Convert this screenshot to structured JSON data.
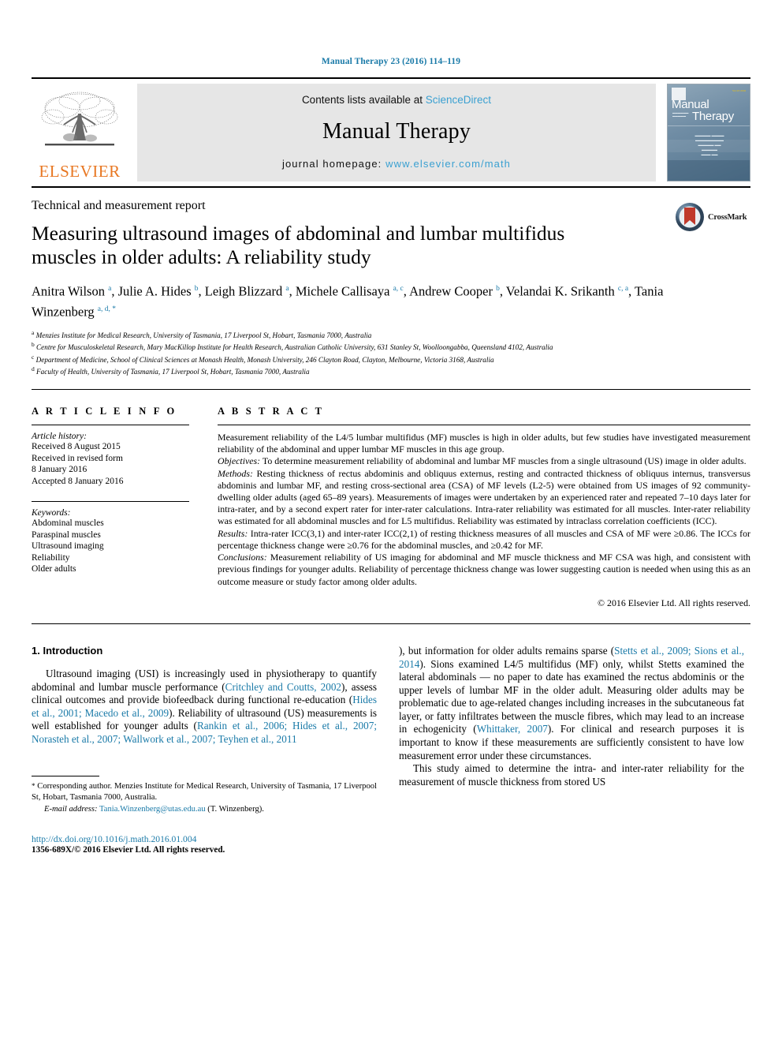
{
  "running_head": "Manual Therapy 23 (2016) 114–119",
  "masthead": {
    "publisher_name": "ELSEVIER",
    "contents_prefix": "Contents lists available at ",
    "contents_link": "ScienceDirect",
    "journal_name": "Manual Therapy",
    "homepage_label": "journal homepage: ",
    "homepage_url": "www.elsevier.com/math",
    "cover": {
      "title_line1": "Manual",
      "title_line2": "Therapy",
      "issue_text": "Vol 23 2016"
    }
  },
  "title_block": {
    "kicker": "Technical and measurement report",
    "title": "Measuring ultrasound images of abdominal and lumbar multifidus muscles in older adults: A reliability study",
    "crossmark_label": "CrossMark",
    "authors": [
      {
        "name": "Anitra Wilson",
        "sup": "a",
        "sep": ", "
      },
      {
        "name": "Julie A. Hides",
        "sup": "b",
        "sep": ", "
      },
      {
        "name": "Leigh Blizzard",
        "sup": "a",
        "sep": ", "
      },
      {
        "name": "Michele Callisaya",
        "sup": "a, c",
        "sep": ", "
      },
      {
        "name": "Andrew Cooper",
        "sup": "b",
        "sep": ", "
      },
      {
        "name": "Velandai K. Srikanth",
        "sup": "c, a",
        "sep": ", "
      },
      {
        "name": "Tania Winzenberg",
        "sup": "a, d, *",
        "sep": ""
      }
    ],
    "affiliations": [
      {
        "marker": "a",
        "text": "Menzies Institute for Medical Research, University of Tasmania, 17 Liverpool St, Hobart, Tasmania 7000, Australia"
      },
      {
        "marker": "b",
        "text": "Centre for Musculoskeletal Research, Mary MacKillop Institute for Health Research, Australian Catholic University, 631 Stanley St, Woolloongabba, Queensland 4102, Australia"
      },
      {
        "marker": "c",
        "text": "Department of Medicine, School of Clinical Sciences at Monash Health, Monash University, 246 Clayton Road, Clayton, Melbourne, Victoria 3168, Australia"
      },
      {
        "marker": "d",
        "text": "Faculty of Health, University of Tasmania, 17 Liverpool St, Hobart, Tasmania 7000, Australia"
      }
    ]
  },
  "article_info": {
    "heading": "A R T I C L E  I N F O",
    "history_label": "Article history:",
    "history_lines": [
      "Received 8 August 2015",
      "Received in revised form",
      "8 January 2016",
      "Accepted 8 January 2016"
    ],
    "keywords_label": "Keywords:",
    "keywords": [
      "Abdominal muscles",
      "Paraspinal muscles",
      "Ultrasound imaging",
      "Reliability",
      "Older adults"
    ]
  },
  "abstract": {
    "heading": "A B S T R A C T",
    "background": "Measurement reliability of the L4/5 lumbar multifidus (MF) muscles is high in older adults, but few studies have investigated measurement reliability of the abdominal and upper lumbar MF muscles in this age group.",
    "objectives_label": "Objectives:",
    "objectives": " To determine measurement reliability of abdominal and lumbar MF muscles from a single ultrasound (US) image in older adults.",
    "methods_label": "Methods:",
    "methods": " Resting thickness of rectus abdominis and obliquus externus, resting and contracted thickness of obliquus internus, transversus abdominis and lumbar MF, and resting cross-sectional area (CSA) of MF levels (L2-5) were obtained from US images of 92 community-dwelling older adults (aged 65–89 years). Measurements of images were undertaken by an experienced rater and repeated 7–10 days later for intra-rater, and by a second expert rater for inter-rater calculations. Intra-rater reliability was estimated for all muscles. Inter-rater reliability was estimated for all abdominal muscles and for L5 multifidus. Reliability was estimated by intraclass correlation coefficients (ICC).",
    "results_label": "Results:",
    "results": " Intra-rater ICC(3,1) and inter-rater ICC(2,1) of resting thickness measures of all muscles and CSA of MF were ≥0.86. The ICCs for percentage thickness change were ≥0.76 for the abdominal muscles, and ≥0.42 for MF.",
    "conclusions_label": "Conclusions:",
    "conclusions": " Measurement reliability of US imaging for abdominal and MF muscle thickness and MF CSA was high, and consistent with previous findings for younger adults. Reliability of percentage thickness change was lower suggesting caution is needed when using this as an outcome measure or study factor among older adults.",
    "copyright": "© 2016 Elsevier Ltd. All rights reserved."
  },
  "body": {
    "section_number_title": "1. Introduction",
    "left_paragraph_parts": [
      {
        "t": "Ultrasound imaging (USI) is increasingly used in physiotherapy to quantify abdominal and lumbar muscle performance (",
        "ref": false
      },
      {
        "t": "Critchley and Coutts, 2002",
        "ref": true
      },
      {
        "t": "), assess clinical outcomes and provide biofeedback during functional re-education (",
        "ref": false
      },
      {
        "t": "Hides et al., 2001; Macedo et al., 2009",
        "ref": true
      },
      {
        "t": "). Reliability of ultrasound (US) measurements is well established for younger adults (",
        "ref": false
      },
      {
        "t": "Rankin et al., 2006; Hides et al., 2007; Norasteh et al., 2007; Wallwork et al., 2007; Teyhen et al., 2011",
        "ref": true
      },
      {
        "t": "), but information for older adults remains sparse (",
        "ref": false
      },
      {
        "t": "Stetts et al., 2009; Sions et al., 2014",
        "ref": true
      },
      {
        "t": "). Sions examined L4/5 multifidus (MF) only, whilst Stetts examined the lateral abdominals — no paper to date has examined the rectus abdominis or the upper levels of lumbar MF in the older adult. Measuring older adults may be problematic due to age-related changes including increases in the subcutaneous fat layer, or fatty infiltrates between the muscle fibres, which may lead to an increase in echogenicity (",
        "ref": false
      },
      {
        "t": "Whittaker, 2007",
        "ref": true
      },
      {
        "t": "). For clinical and research purposes it is important to know if these measurements are sufficiently consistent to have low measurement error under these circumstances.",
        "ref": false
      }
    ],
    "final_paragraph": "This study aimed to determine the intra- and inter-rater reliability for the measurement of muscle thickness from stored US"
  },
  "footnote": {
    "star": "*",
    "corresponding": " Corresponding author. Menzies Institute for Medical Research, University of Tasmania, 17 Liverpool St, Hobart, Tasmania 7000, Australia.",
    "email_label": "E-mail address:",
    "email": "Tania.Winzenberg@utas.edu.au",
    "email_suffix": " (T. Winzenberg)."
  },
  "doi_block": {
    "doi_url": "http://dx.doi.org/10.1016/j.math.2016.01.004",
    "issn_line": "1356-689X/© 2016 Elsevier Ltd. All rights reserved."
  },
  "colors": {
    "link_blue": "#1a7aa8",
    "sciencedirect_blue": "#3aa0d1",
    "elsevier_orange": "#E87722",
    "crossmark_red": "#c0392b"
  }
}
